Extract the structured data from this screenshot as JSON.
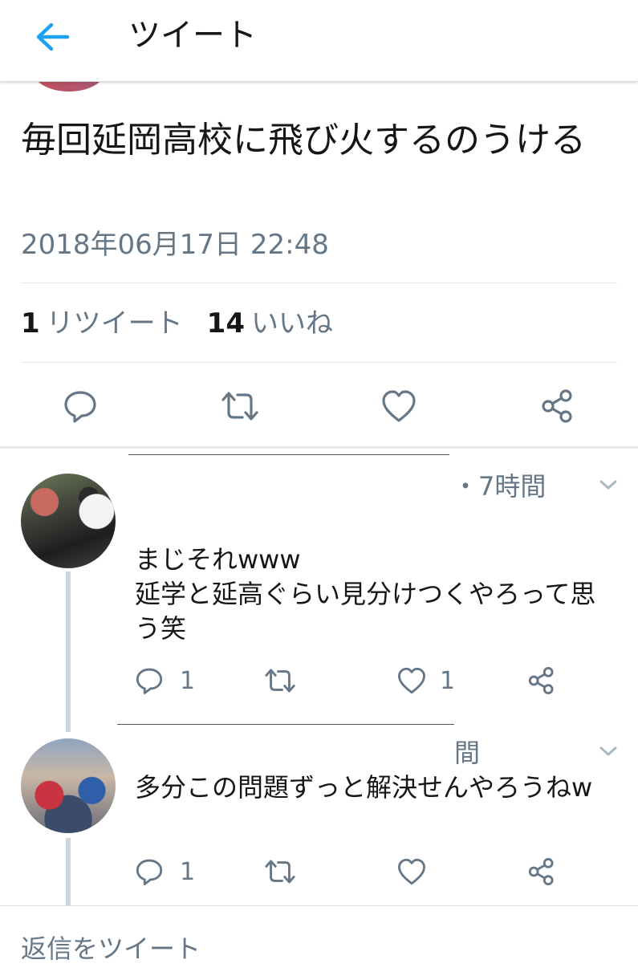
{
  "header": {
    "title": "ツイート",
    "back_icon": "arrow-left-icon",
    "accent": "#1da1f2"
  },
  "tweet": {
    "text": "毎回延岡高校に飛び火するのうける",
    "timestamp": "2018年06月17日 22:48",
    "retweets": {
      "count": "1",
      "label": "リツイート"
    },
    "likes": {
      "count": "14",
      "label": "いいね"
    },
    "actions": [
      "reply-icon",
      "retweet-icon",
      "like-icon",
      "share-icon"
    ]
  },
  "replies": [
    {
      "time": "・7時間",
      "text_lines": [
        "まじそれwww",
        "延学と延高ぐらい見分けつくやろって思",
        "う笑"
      ],
      "reply_count": "1",
      "like_count": "1"
    },
    {
      "time": "間",
      "text_lines": [
        "多分この問題ずっと解決せんやろうねw"
      ],
      "reply_count": "1",
      "like_count": ""
    }
  ],
  "composer": {
    "placeholder": "返信をツイート"
  },
  "colors": {
    "text": "#14171a",
    "secondary": "#657786",
    "divider": "#e1e8ed",
    "icon": "#657786"
  }
}
